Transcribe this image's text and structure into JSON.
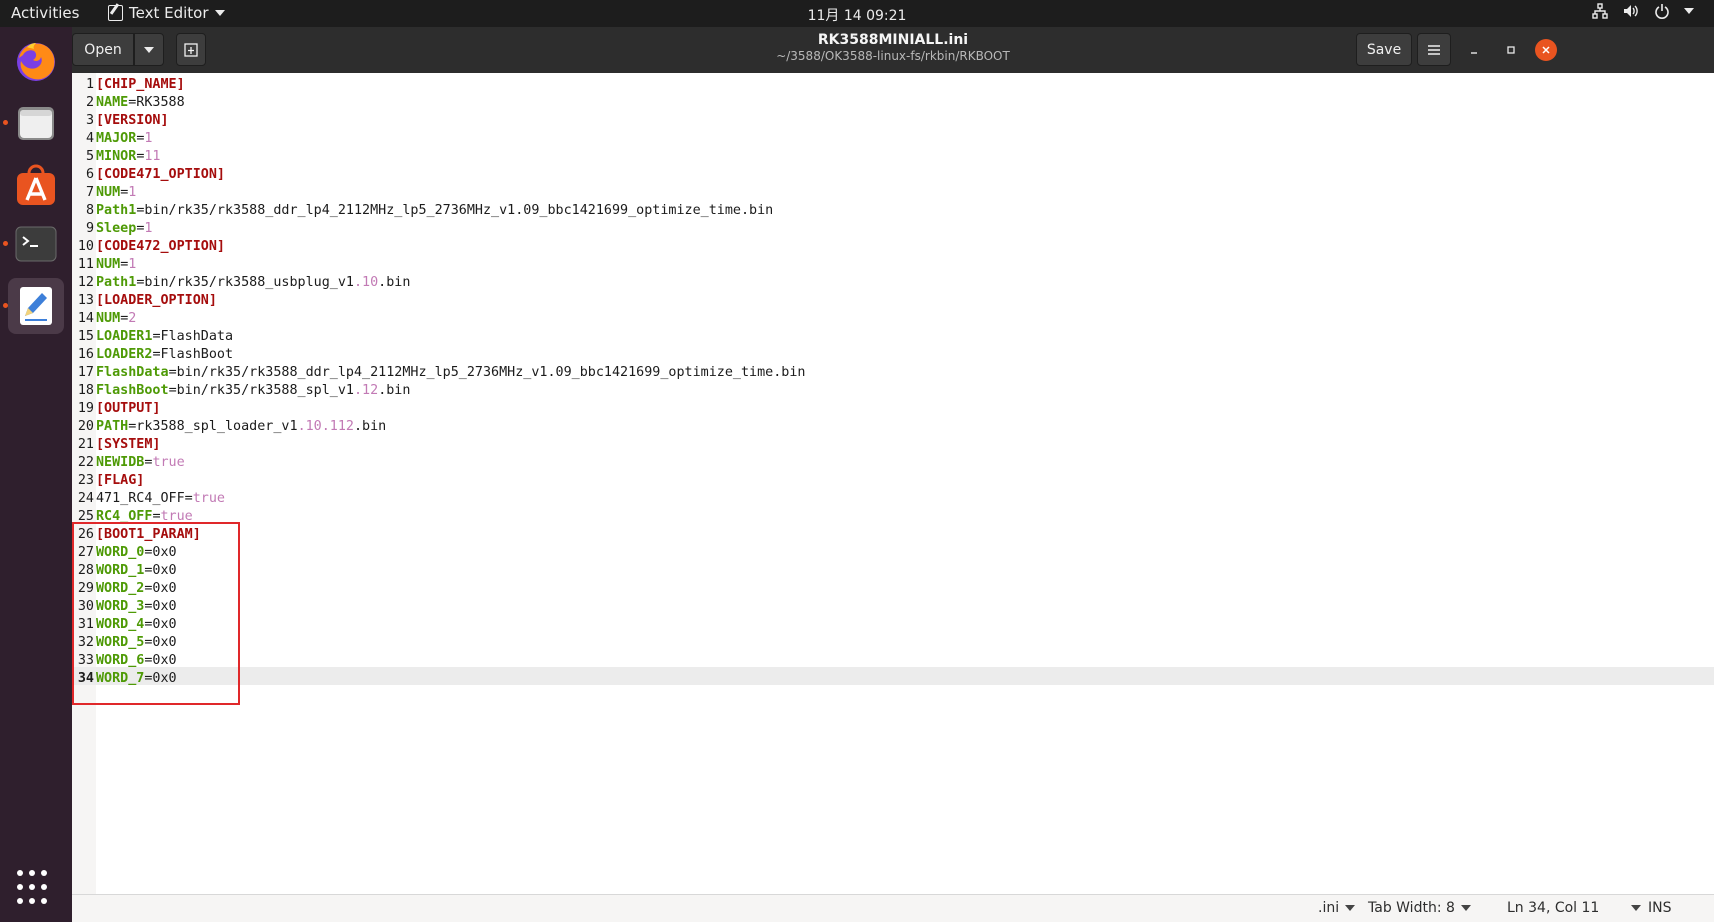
{
  "topbar": {
    "activities": "Activities",
    "app_menu_label": "Text Editor",
    "clock": "11月 14  09:21"
  },
  "dock": {
    "apps": [
      "firefox-icon",
      "files-icon",
      "software-icon",
      "terminal-icon",
      "text-editor-icon"
    ],
    "running_indicator_color": "#e95420"
  },
  "headerbar": {
    "open_label": "Open",
    "title": "RK3588MINIALL.ini",
    "subtitle": "~/3588/OK3588-linux-fs/rkbin/RKBOOT",
    "save_label": "Save"
  },
  "editor": {
    "current_line": 34,
    "lines": [
      [
        [
          "sec",
          "[CHIP_NAME]"
        ]
      ],
      [
        [
          "key",
          "NAME"
        ],
        [
          "code",
          "=RK3588"
        ]
      ],
      [
        [
          "sec",
          "[VERSION]"
        ]
      ],
      [
        [
          "key",
          "MAJOR"
        ],
        [
          "code",
          "="
        ],
        [
          "num",
          "1"
        ]
      ],
      [
        [
          "key",
          "MINOR"
        ],
        [
          "code",
          "="
        ],
        [
          "num",
          "11"
        ]
      ],
      [
        [
          "sec",
          "[CODE471_OPTION]"
        ]
      ],
      [
        [
          "key",
          "NUM"
        ],
        [
          "code",
          "="
        ],
        [
          "num",
          "1"
        ]
      ],
      [
        [
          "key",
          "Path1"
        ],
        [
          "code",
          "=bin/rk35/rk3588_ddr_lp4_2112MHz_lp5_2736MHz_v1.09_bbc1421699_optimize_time.bin"
        ]
      ],
      [
        [
          "key",
          "Sleep"
        ],
        [
          "code",
          "="
        ],
        [
          "num",
          "1"
        ]
      ],
      [
        [
          "sec",
          "[CODE472_OPTION]"
        ]
      ],
      [
        [
          "key",
          "NUM"
        ],
        [
          "code",
          "="
        ],
        [
          "num",
          "1"
        ]
      ],
      [
        [
          "key",
          "Path1"
        ],
        [
          "code",
          "=bin/rk35/rk3588_usbplug_v1"
        ],
        [
          "num",
          ".10"
        ],
        [
          "code",
          ".bin"
        ]
      ],
      [
        [
          "sec",
          "[LOADER_OPTION]"
        ]
      ],
      [
        [
          "key",
          "NUM"
        ],
        [
          "code",
          "="
        ],
        [
          "num",
          "2"
        ]
      ],
      [
        [
          "key",
          "LOADER1"
        ],
        [
          "code",
          "=FlashData"
        ]
      ],
      [
        [
          "key",
          "LOADER2"
        ],
        [
          "code",
          "=FlashBoot"
        ]
      ],
      [
        [
          "key",
          "FlashData"
        ],
        [
          "code",
          "=bin/rk35/rk3588_ddr_lp4_2112MHz_lp5_2736MHz_v1.09_bbc1421699_optimize_time.bin"
        ]
      ],
      [
        [
          "key",
          "FlashBoot"
        ],
        [
          "code",
          "=bin/rk35/rk3588_spl_v1"
        ],
        [
          "num",
          ".12"
        ],
        [
          "code",
          ".bin"
        ]
      ],
      [
        [
          "sec",
          "[OUTPUT]"
        ]
      ],
      [
        [
          "key",
          "PATH"
        ],
        [
          "code",
          "=rk3588_spl_loader_v1"
        ],
        [
          "num",
          ".10.112"
        ],
        [
          "code",
          ".bin"
        ]
      ],
      [
        [
          "sec",
          "[SYSTEM]"
        ]
      ],
      [
        [
          "key",
          "NEWIDB"
        ],
        [
          "code",
          "="
        ],
        [
          "num",
          "true"
        ]
      ],
      [
        [
          "sec",
          "[FLAG]"
        ]
      ],
      [
        [
          "code",
          "471_RC4_OFF="
        ],
        [
          "num",
          "true"
        ]
      ],
      [
        [
          "key",
          "RC4_OFF"
        ],
        [
          "code",
          "="
        ],
        [
          "num",
          "true"
        ]
      ],
      [
        [
          "sec",
          "[BOOT1_PARAM]"
        ]
      ],
      [
        [
          "key",
          "WORD_0"
        ],
        [
          "code",
          "=0x0"
        ]
      ],
      [
        [
          "key",
          "WORD_1"
        ],
        [
          "code",
          "=0x0"
        ]
      ],
      [
        [
          "key",
          "WORD_2"
        ],
        [
          "code",
          "=0x0"
        ]
      ],
      [
        [
          "key",
          "WORD_3"
        ],
        [
          "code",
          "=0x0"
        ]
      ],
      [
        [
          "key",
          "WORD_4"
        ],
        [
          "code",
          "=0x0"
        ]
      ],
      [
        [
          "key",
          "WORD_5"
        ],
        [
          "code",
          "=0x0"
        ]
      ],
      [
        [
          "key",
          "WORD_6"
        ],
        [
          "code",
          "=0x0"
        ]
      ],
      [
        [
          "key",
          "WORD_7"
        ],
        [
          "code",
          "=0x0"
        ]
      ]
    ]
  },
  "statusbar": {
    "language": ".ini",
    "tab_width": "Tab Width: 8",
    "position": "Ln 34, Col 11",
    "mode": "INS"
  },
  "colors": {
    "section": "#a50d0d",
    "key": "#4e9a06",
    "number": "#c27ab5",
    "highlight_box": "#e0282a"
  }
}
